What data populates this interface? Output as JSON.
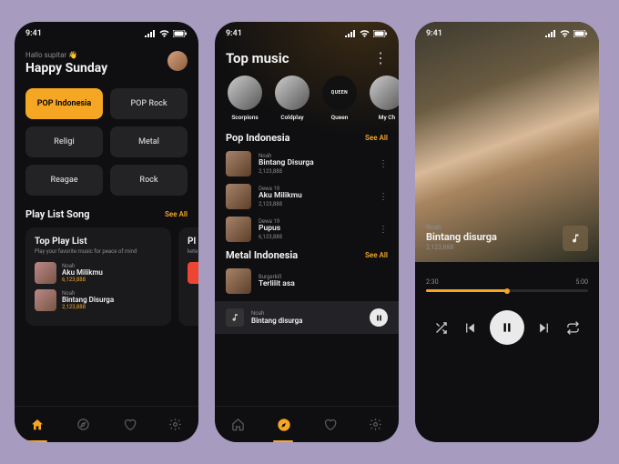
{
  "status": {
    "time": "9:41"
  },
  "greeting": {
    "sub": "Hallo supitar 👋",
    "main": "Happy Sunday"
  },
  "chips": [
    "POP Indonesia",
    "POP Rock",
    "Religi",
    "Metal",
    "Reagae",
    "Rock"
  ],
  "playlist": {
    "section": "Play List Song",
    "seeAll": "See All",
    "card": {
      "title": "Top Play List",
      "sub": "Play your favorite music for peace of mind"
    },
    "card2": {
      "title": "Pl",
      "sub": "kete"
    },
    "tracks": [
      {
        "artist": "Noah",
        "title": "Aku Milikmu",
        "plays": "6,123,888"
      },
      {
        "artist": "Noah",
        "title": "Bintang Disurga",
        "plays": "2,123,888"
      }
    ]
  },
  "top": {
    "title": "Top music",
    "artists": [
      "Scorpions",
      "Coldplay",
      "Queen",
      "My Ch"
    ]
  },
  "popInd": {
    "title": "Pop Indonesia",
    "seeAll": "See All",
    "tracks": [
      {
        "artist": "Noah",
        "title": "Bintang Disurga",
        "plays": "2,123,888"
      },
      {
        "artist": "Dewa 19",
        "title": "Aku Milikmu",
        "plays": "2,123,888"
      },
      {
        "artist": "Dewa 19",
        "title": "Pupus",
        "plays": "6,123,888"
      }
    ]
  },
  "metalInd": {
    "title": "Metal Indonesia",
    "seeAll": "See All",
    "tracks": [
      {
        "artist": "Burgerkill",
        "title": "Terlilit asa"
      }
    ]
  },
  "nowPlaying": {
    "artist": "Noah",
    "title": "Bintang disurga"
  },
  "player": {
    "artist": "Noah",
    "title": "Bintang disurga",
    "plays": "2,123,888",
    "elapsed": "2:30",
    "total": "5:00",
    "progress": 50
  }
}
